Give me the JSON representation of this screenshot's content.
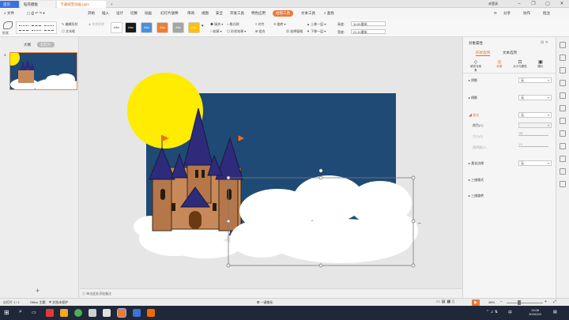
{
  "titlebar": {
    "home_tab": "首页",
    "tab1": "稻壳模板",
    "tab2": "卡通城堡动画.pptx",
    "new_tab": "+",
    "login": "未登录"
  },
  "menu": {
    "file": "≡ 文件",
    "items": [
      "开始",
      "插入",
      "设计",
      "切换",
      "动画",
      "幻灯片放映",
      "审阅",
      "视图",
      "安全",
      "开发工具",
      "特色应用"
    ],
    "active": "绘图工具",
    "extra": "文本工具",
    "search": "查找",
    "share_btn": "分享",
    "collab_btn": "协作",
    "comment_btn": "批注"
  },
  "toolbar": {
    "shape_label": "形状",
    "edit_shape": "编辑形状",
    "text_box": "文本框",
    "merge_shape": "合并形状",
    "styles": [
      "Abc",
      "Abc",
      "Abc",
      "Abc",
      "Abc",
      "Abc"
    ],
    "style_colors": [
      "#ffffff",
      "#1a1a1a",
      "#4a90d9",
      "#ed7d31",
      "#a5a5a5",
      "#ffc000"
    ],
    "fill": "填充",
    "outline": "轮廓",
    "shape_effect": "形状效果",
    "format_brush": "格式刷",
    "align": "对齐",
    "group": "组合",
    "rotate": "旋转",
    "select_pane": "选择窗格",
    "bring_forward": "上移一层",
    "send_backward": "下移一层",
    "height_label": "高度:",
    "height_value": "11.81厘米",
    "width_label": "宽度:",
    "width_value": "21.11厘米"
  },
  "leftpane": {
    "tab_outline": "大纲",
    "tab_slides": "幻灯片",
    "slide_number": "1",
    "add_slide": "+"
  },
  "canvas": {
    "notes_placeholder": "单击此处添加备注"
  },
  "rightpanel": {
    "title": "对象属性",
    "tab_shape": "形状选项",
    "tab_text": "文本选项",
    "sub_tabs": [
      "填充与线条",
      "效果",
      "大小与属性",
      "图片"
    ],
    "sections": [
      {
        "label": "阴影",
        "value": "无"
      },
      {
        "label": "倒影",
        "value": "无"
      },
      {
        "label": "发光",
        "value": "无"
      }
    ],
    "color_label": "颜色(C)",
    "size_label": "大小(S)",
    "size_value": "0磅",
    "transparency_label": "透明度(T)",
    "transparency_value": "0%",
    "soft_edge_label": "柔化边缘",
    "soft_edge_value": "无",
    "three_d_format": "三维格式",
    "three_d_rotation": "三维旋转"
  },
  "statusbar": {
    "slide_info": "幻灯片 1 / 1",
    "theme": "Office 主题",
    "doc_protect": "文档未保护",
    "smart_beautify": "一键美化",
    "zoom": "48%"
  },
  "taskbar": {
    "time": "13:08",
    "date": "2020/2/3",
    "ime": "中"
  },
  "colors": {
    "accent": "#e97a3a",
    "sky": "#1f4a75",
    "sun": "#ffec00",
    "home_tab": "#3b72d9"
  }
}
